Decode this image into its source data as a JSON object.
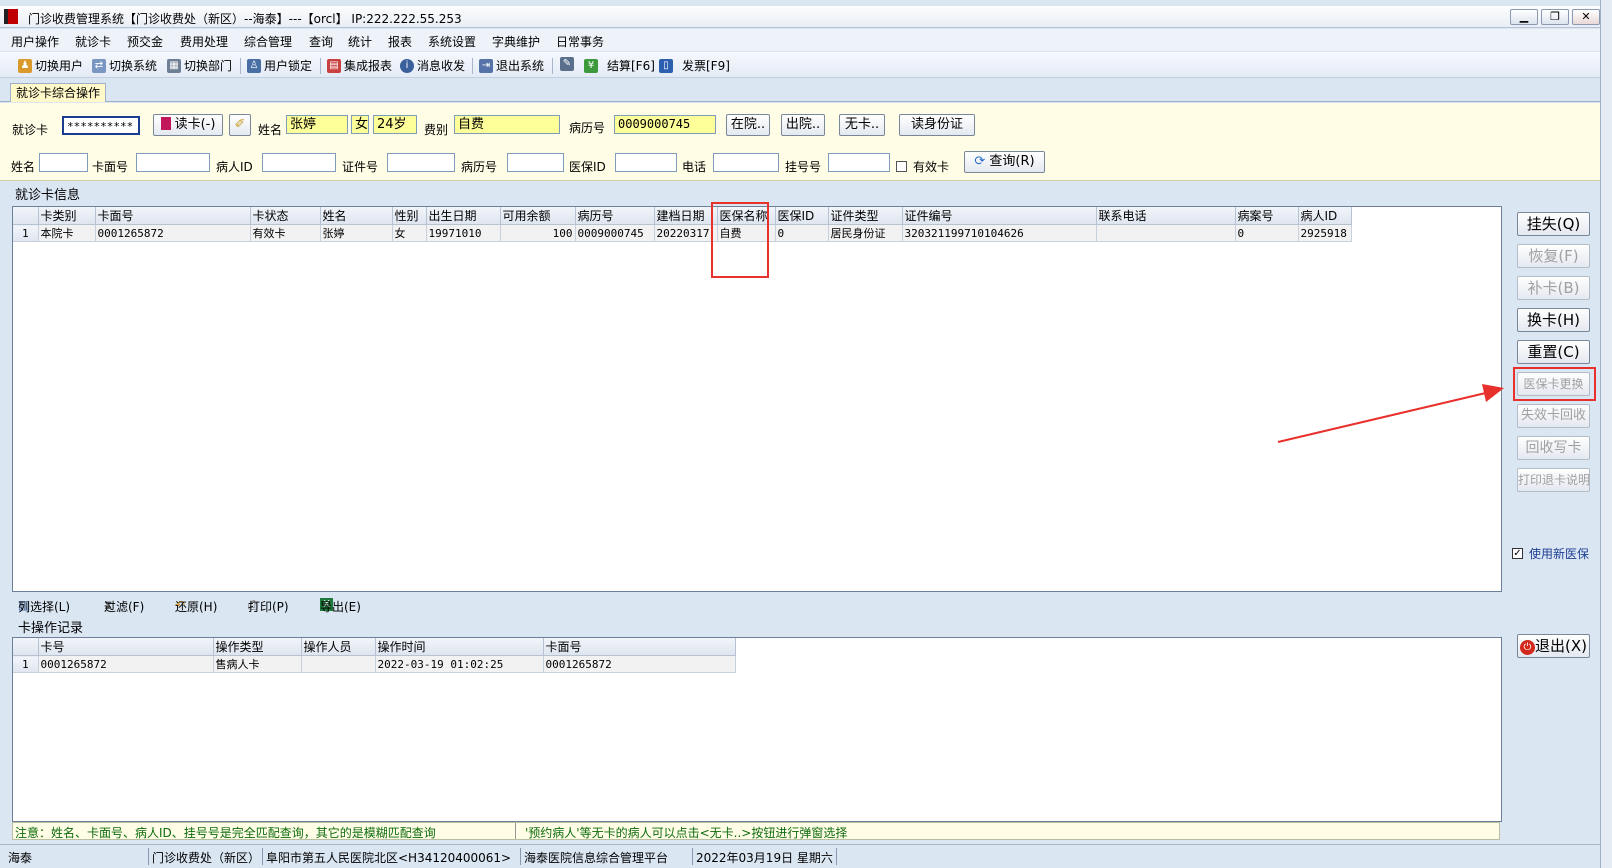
{
  "window": {
    "title": "门诊收费管理系统【门诊收费处（新区）--海泰】---【orcl】 IP:222.222.55.253"
  },
  "menu": [
    "用户操作",
    "就诊卡",
    "预交金",
    "费用处理",
    "综合管理",
    "查询",
    "统计",
    "报表",
    "系统设置",
    "字典维护",
    "日常事务"
  ],
  "toolbar": {
    "switch_user": "切换用户",
    "switch_system": "切换系统",
    "switch_dept": "切换部门",
    "lock_user": "用户锁定",
    "report": "集成报表",
    "message": "消息收发",
    "exit_system": "退出系统",
    "settle": "结算[F6]",
    "invoice": "发票[F9]"
  },
  "tab": {
    "label": "就诊卡综合操作"
  },
  "card_form": {
    "card_label": "就诊卡",
    "card_value": "**********",
    "read_card": "读卡(-)",
    "name_label": "姓名",
    "name_value": "张婷",
    "gender": "女",
    "age": "24岁",
    "fee_type_label": "费别",
    "fee_type_value": "自费",
    "record_label": "病历号",
    "record_value": "0009000745",
    "in_hospital": "在院..",
    "discharged": "出院..",
    "no_card": "无卡..",
    "read_id": "读身份证"
  },
  "search_form": {
    "name": "姓名",
    "card_no": "卡面号",
    "patient_id": "病人ID",
    "id_no": "证件号",
    "record_no": "病历号",
    "insurance_id": "医保ID",
    "phone": "电话",
    "reg_no": "挂号号",
    "valid_card": "有效卡",
    "query": "查询(R)"
  },
  "card_info": {
    "title": "就诊卡信息",
    "columns": [
      "卡类别",
      "卡面号",
      "卡状态",
      "姓名",
      "性别",
      "出生日期",
      "可用余额",
      "病历号",
      "建档日期",
      "医保名称",
      "医保ID",
      "证件类型",
      "证件编号",
      "联系电话",
      "病案号",
      "病人ID"
    ],
    "rows": [
      [
        "1",
        "本院卡",
        "0001265872",
        "有效卡",
        "张婷",
        "女",
        "19971010",
        "100",
        "0009000745",
        "20220317",
        "自费",
        "0",
        "居民身份证",
        "320321199710104626",
        "",
        "0",
        "2925918"
      ]
    ]
  },
  "grid_tools": {
    "col_select": "列选择(L)",
    "filter": "过滤(F)",
    "restore": "还原(H)",
    "print": "打印(P)",
    "export": "导出(E)"
  },
  "card_ops": {
    "title": "卡操作记录",
    "columns": [
      "卡号",
      "操作类型",
      "操作人员",
      "操作时间",
      "卡面号"
    ],
    "rows": [
      [
        "1",
        "0001265872",
        "售病人卡",
        "",
        "2022-03-19 01:02:25",
        "0001265872"
      ]
    ]
  },
  "side_buttons": {
    "lose": "挂失(Q)",
    "recover": "恢复(F)",
    "reissue": "补卡(B)",
    "replace": "换卡(H)",
    "reset": "重置(C)",
    "insurance_change": "医保卡更换",
    "invalid_recycle": "失效卡回收",
    "recycle_write": "回收写卡",
    "print_refund": "打印退卡说明",
    "use_new_insurance": "使用新医保",
    "exit": "退出(X)"
  },
  "notice": {
    "left": "注意：姓名、卡面号、病人ID、挂号号是完全匹配查询，其它的是模糊匹配查询",
    "right": "'预约病人'等无卡的病人可以点击<无卡..>按钮进行弹窗选择"
  },
  "status": {
    "user": "海泰",
    "dept": "门诊收费处（新区）",
    "hospital": "阜阳市第五人民医院北区<H34120400061>",
    "platform": "海泰医院信息综合管理平台",
    "date": "2022年03月19日 星期六"
  },
  "colors": {
    "highlight_red": "#e8302c",
    "notice_green": "#0c6b0c",
    "input_yellow": "#ffff99"
  }
}
